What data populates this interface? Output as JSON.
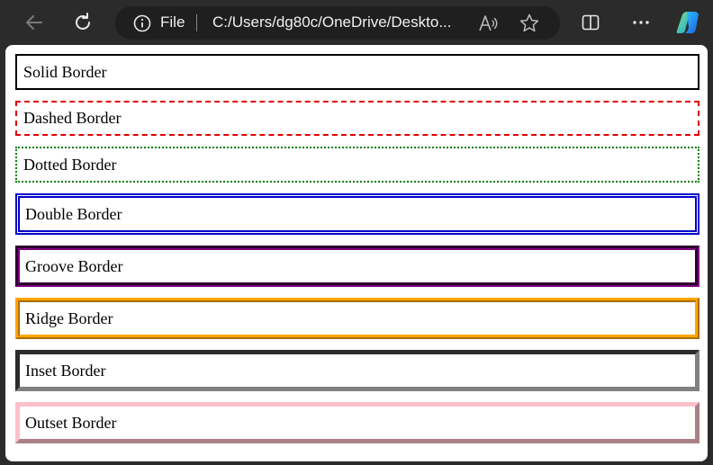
{
  "browser": {
    "address_scheme": "File",
    "address_url": "C:/Users/dg80c/OneDrive/Deskto...",
    "icons": {
      "back": "back-arrow-icon",
      "refresh": "refresh-icon",
      "info": "info-icon",
      "read_aloud": "read-aloud-icon",
      "favorite": "star-icon",
      "split_screen": "split-screen-icon",
      "more": "more-dots-icon",
      "copilot": "copilot-icon"
    }
  },
  "boxes": [
    {
      "label": "Solid Border",
      "style": "solid",
      "color": "#000000"
    },
    {
      "label": "Dashed Border",
      "style": "dashed",
      "color": "#e00000"
    },
    {
      "label": "Dotted Border",
      "style": "dotted",
      "color": "#008000"
    },
    {
      "label": "Double Border",
      "style": "double",
      "color": "#0000cc"
    },
    {
      "label": "Groove Border",
      "style": "groove",
      "color": "#800080"
    },
    {
      "label": "Ridge Border",
      "style": "ridge",
      "color": "#ffa500"
    },
    {
      "label": "Inset Border",
      "style": "inset",
      "color": "#808080"
    },
    {
      "label": "Outset Border",
      "style": "outset",
      "color": "#ffc0cb"
    }
  ]
}
